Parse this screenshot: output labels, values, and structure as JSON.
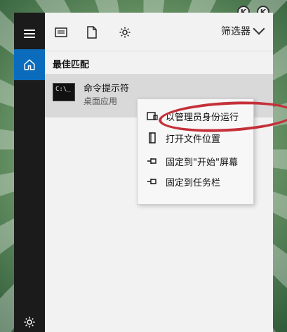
{
  "desktop": {
    "icons": [
      {
        "icon": "app-badge-icon",
        "glyph": "K"
      },
      {
        "icon": "app-badge-icon",
        "glyph": "K"
      }
    ]
  },
  "start_panel": {
    "left_rail": {
      "items": [
        {
          "name": "hamburger-menu",
          "icon": "hamburger-icon"
        },
        {
          "name": "home",
          "icon": "home-icon",
          "active": true
        },
        {
          "name": "settings",
          "icon": "gear-icon"
        }
      ]
    },
    "topbar": {
      "icons": [
        "document-list-icon",
        "document-icon",
        "gear-icon"
      ],
      "filter_label": "筛选器"
    },
    "section_title": "最佳匹配",
    "result": {
      "title": "命令提示符",
      "subtitle": "桌面应用",
      "icon": "cmd-icon",
      "icon_prompt": "C:\\_"
    },
    "context_menu": {
      "items": [
        {
          "label": "以管理员身份运行",
          "icon": "admin-run-icon"
        },
        {
          "label": "打开文件位置",
          "icon": "file-location-icon"
        },
        {
          "label": "固定到\"开始\"屏幕",
          "icon": "pin-icon"
        },
        {
          "label": "固定到任务栏",
          "icon": "pin-icon"
        }
      ]
    },
    "annotation_color": "#c5303a"
  }
}
